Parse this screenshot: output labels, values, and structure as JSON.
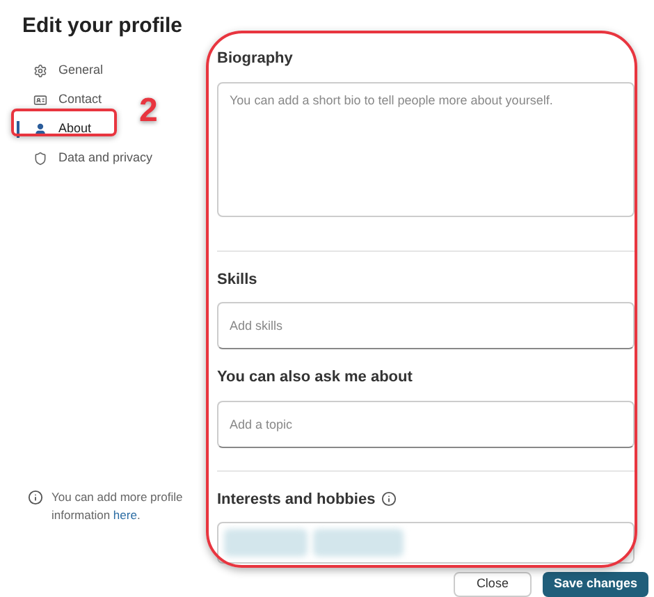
{
  "title": "Edit your profile",
  "nav": [
    {
      "label": "General",
      "selected": false
    },
    {
      "label": "Contact",
      "selected": false
    },
    {
      "label": "About",
      "selected": true
    },
    {
      "label": "Data and privacy",
      "selected": false
    }
  ],
  "info_note": {
    "text": "You can add more profile information ",
    "link": "here",
    "after": "."
  },
  "sections": [
    {
      "kind": "textarea",
      "label": "Biography",
      "placeholder": "You can add a short bio to tell people more about yourself."
    },
    {
      "kind": "input",
      "label": "Skills",
      "placeholder": "Add skills"
    },
    {
      "kind": "input",
      "label": "You can also ask me about",
      "placeholder": "Add a topic"
    },
    {
      "kind": "tags",
      "label": "Interests and hobbies"
    }
  ],
  "buttons": [
    {
      "label": "Close"
    },
    {
      "label": "Save changes"
    }
  ],
  "annotation": {
    "step": "2"
  }
}
